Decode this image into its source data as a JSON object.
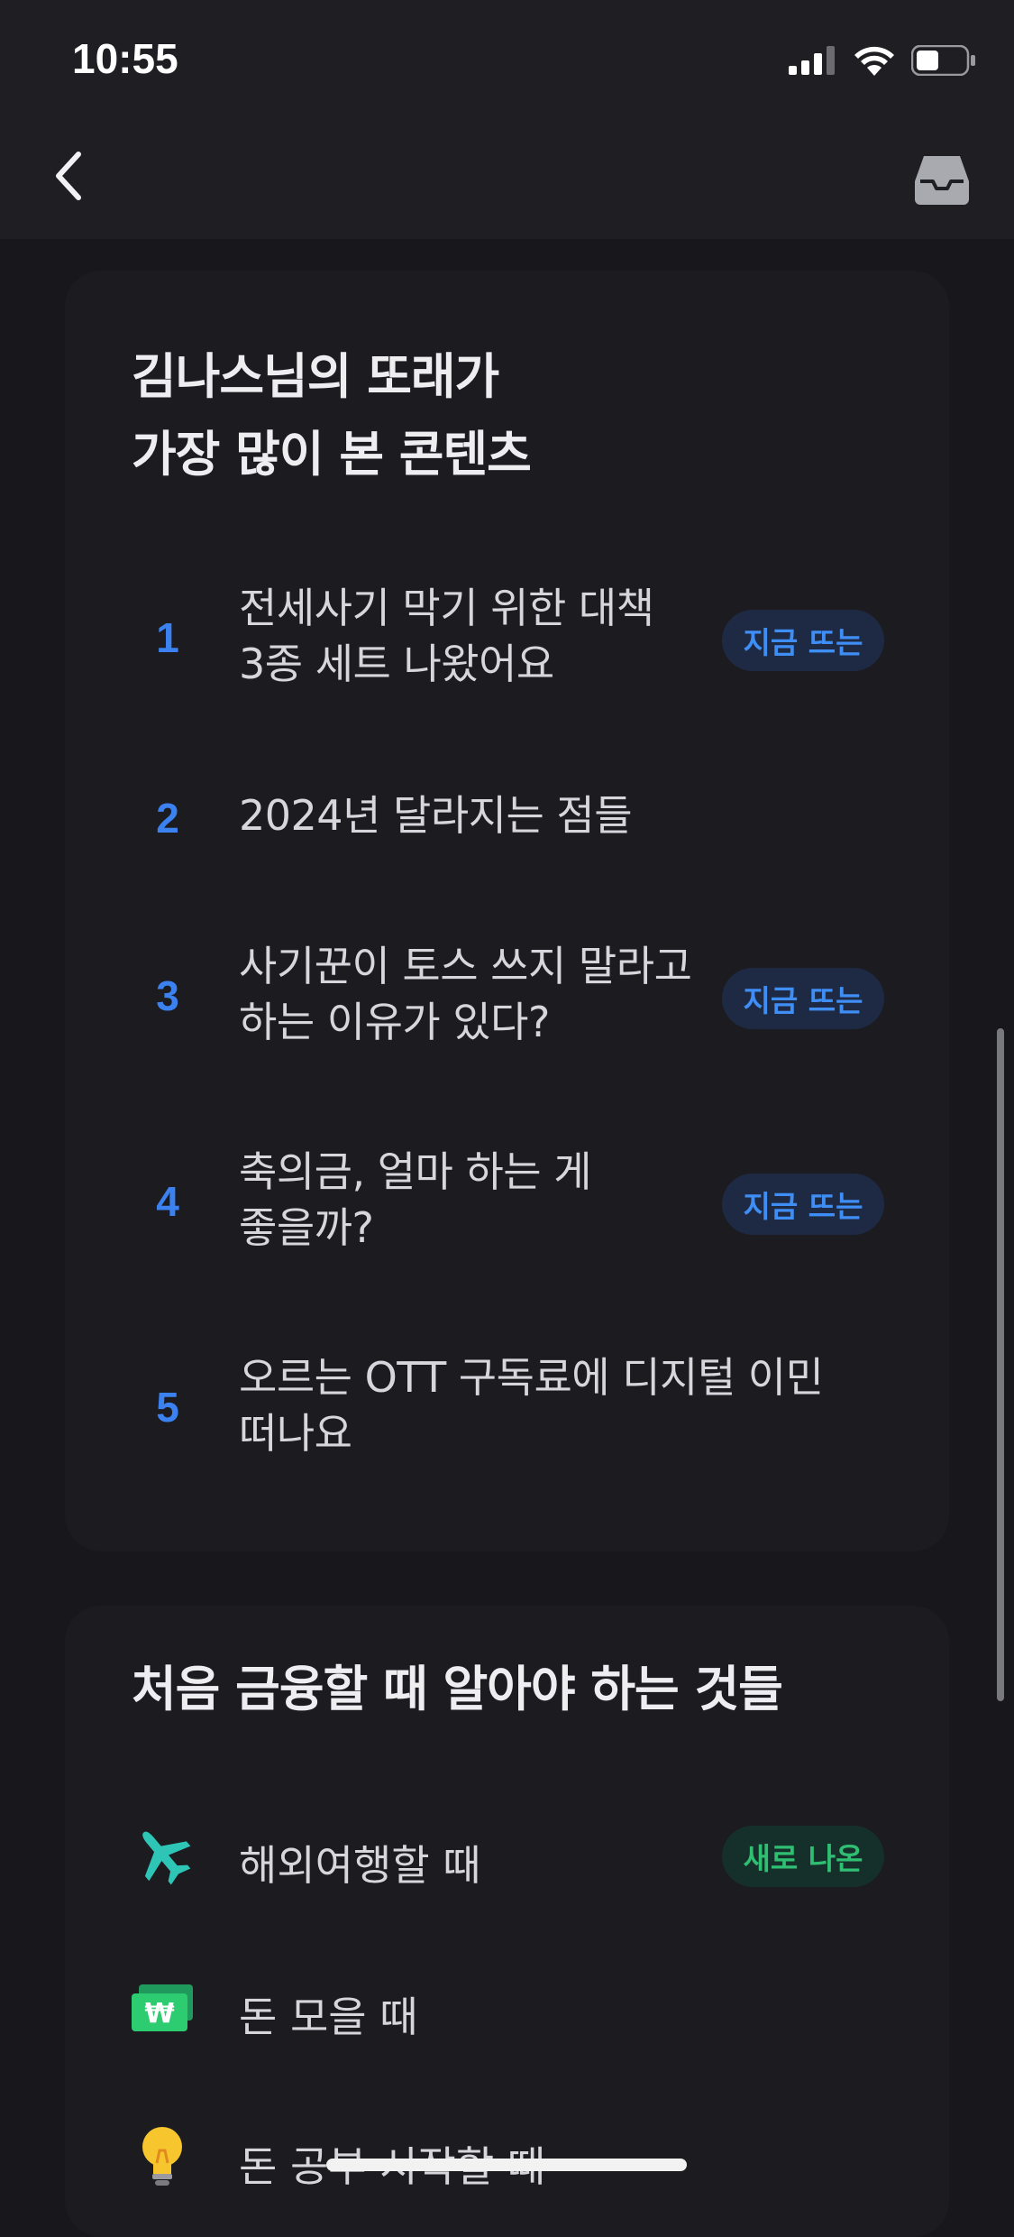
{
  "status_bar": {
    "time": "10:55"
  },
  "section_top": {
    "title_line1": "김나스님의 또래가",
    "title_line2": "가장 많이 본 콘텐츠",
    "items": [
      {
        "rank": "1",
        "line1": "전세사기 막기 위한 대책",
        "line2": "3종 세트 나왔어요",
        "badge": "지금 뜨는"
      },
      {
        "rank": "2",
        "line1": "2024년 달라지는 점들",
        "line2": "",
        "badge": ""
      },
      {
        "rank": "3",
        "line1": "사기꾼이 토스 쓰지 말라고",
        "line2": "하는 이유가 있다?",
        "badge": "지금 뜨는"
      },
      {
        "rank": "4",
        "line1": "축의금, 얼마 하는 게",
        "line2": "좋을까?",
        "badge": "지금 뜨는"
      },
      {
        "rank": "5",
        "line1": "오르는 OTT 구독료에 디지털 이민",
        "line2": "떠나요",
        "badge": ""
      }
    ]
  },
  "section_guide": {
    "title": "처음 금융할 때 알아야 하는 것들",
    "items": [
      {
        "icon": "airplane-icon",
        "label": "해외여행할 때",
        "badge": "새로 나온"
      },
      {
        "icon": "won-bill-icon",
        "label": "돈 모을 때",
        "badge": ""
      },
      {
        "icon": "lightbulb-icon",
        "label": "돈 공부 시작할 때",
        "badge": ""
      }
    ]
  },
  "colors": {
    "background": "#17171c",
    "card": "#1b1b20",
    "rank_number": "#3b82f0",
    "badge_blue_text": "#3f8ef5",
    "badge_green_text": "#2fbe72"
  }
}
